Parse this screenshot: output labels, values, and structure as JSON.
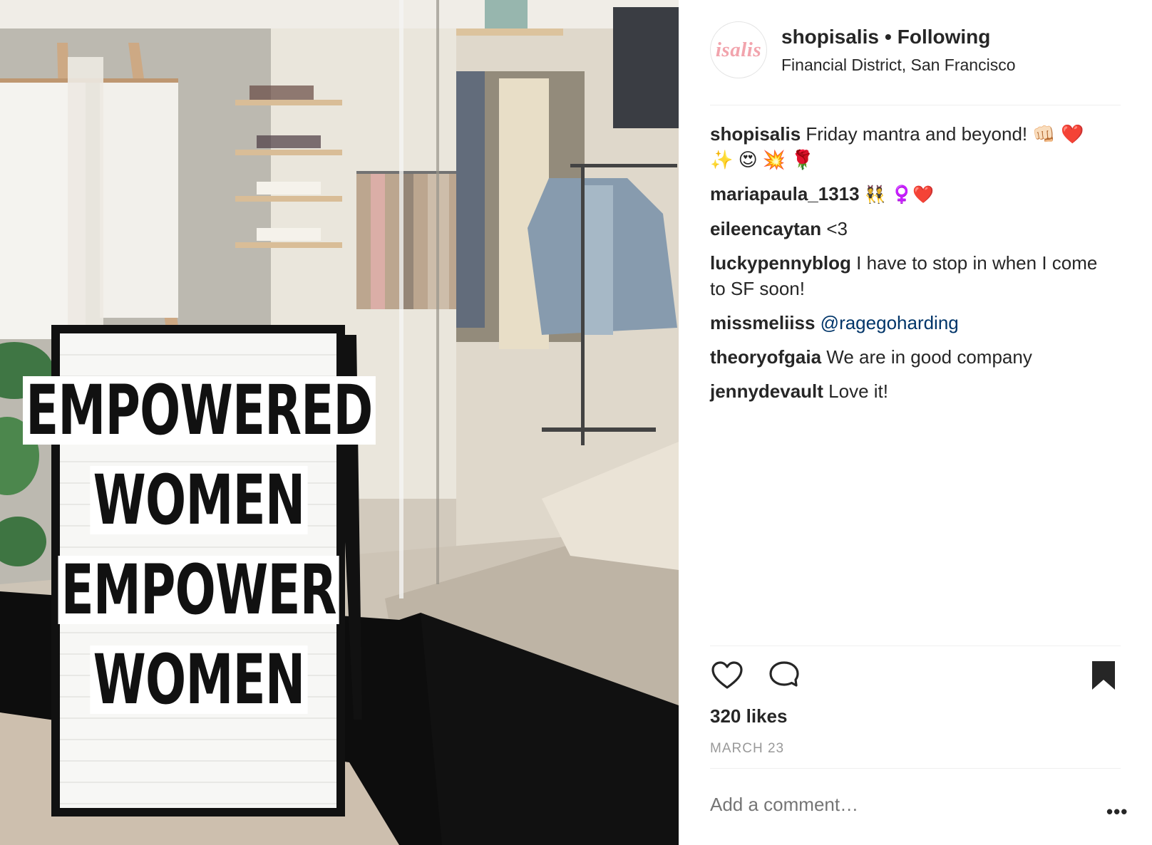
{
  "post": {
    "sign_lines": [
      "EMPOWERED",
      "WOMEN",
      "EMPOWER",
      "WOMEN"
    ]
  },
  "header": {
    "avatar_text": "isalis",
    "username": "shopisalis",
    "separator": "•",
    "follow_status": "Following",
    "location": "Financial District, San Francisco"
  },
  "comments": [
    {
      "user": "shopisalis",
      "text": "Friday mantra and beyond! 👊🏻 ❤️ ✨ 😍 💥 🌹"
    },
    {
      "user": "mariapaula_1313",
      "text": "👯 ♀️❤️"
    },
    {
      "user": "eileencaytan",
      "text": "<3"
    },
    {
      "user": "luckypennyblog",
      "text": "I have to stop in when I come to SF soon!"
    },
    {
      "user": "missmeliiss",
      "mention": "@ragegoharding"
    },
    {
      "user": "theoryofgaia",
      "text": "We are in good company"
    },
    {
      "user": "jennydevault",
      "text": "Love it!"
    }
  ],
  "actions": {
    "like_icon": "heart-icon",
    "comment_icon": "speech-bubble-icon",
    "save_icon": "bookmark-icon"
  },
  "likes": "320 likes",
  "date": "MARCH 23",
  "add_comment_placeholder": "Add a comment…",
  "more_label": "•••",
  "colors": {
    "link": "#003569",
    "muted": "#999999",
    "text": "#262626",
    "avatar_accent": "#f2a4ad"
  }
}
